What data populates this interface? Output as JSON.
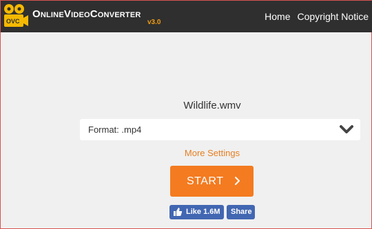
{
  "header": {
    "logo_badge": "OVC",
    "logo_text_main": "OnlineVideoConverter",
    "logo_version": "v3.0",
    "nav": [
      {
        "label": "Home"
      },
      {
        "label": "Copyright Notice"
      }
    ]
  },
  "main": {
    "filename": "Wildlife.wmv",
    "format_select": {
      "label": "Format: .mp4",
      "icon": "chevron-down-icon"
    },
    "more_settings": "More Settings",
    "start_button": {
      "label": "START",
      "icon": "chevron-right-icon"
    },
    "facebook": {
      "like_label": "Like 1.6M",
      "share_label": "Share"
    }
  },
  "colors": {
    "header_bg": "#2f2f2f",
    "accent": "#f47b20",
    "logo_yellow": "#f5b800",
    "facebook_blue": "#4267b2",
    "page_bg": "#f0f0f0"
  }
}
